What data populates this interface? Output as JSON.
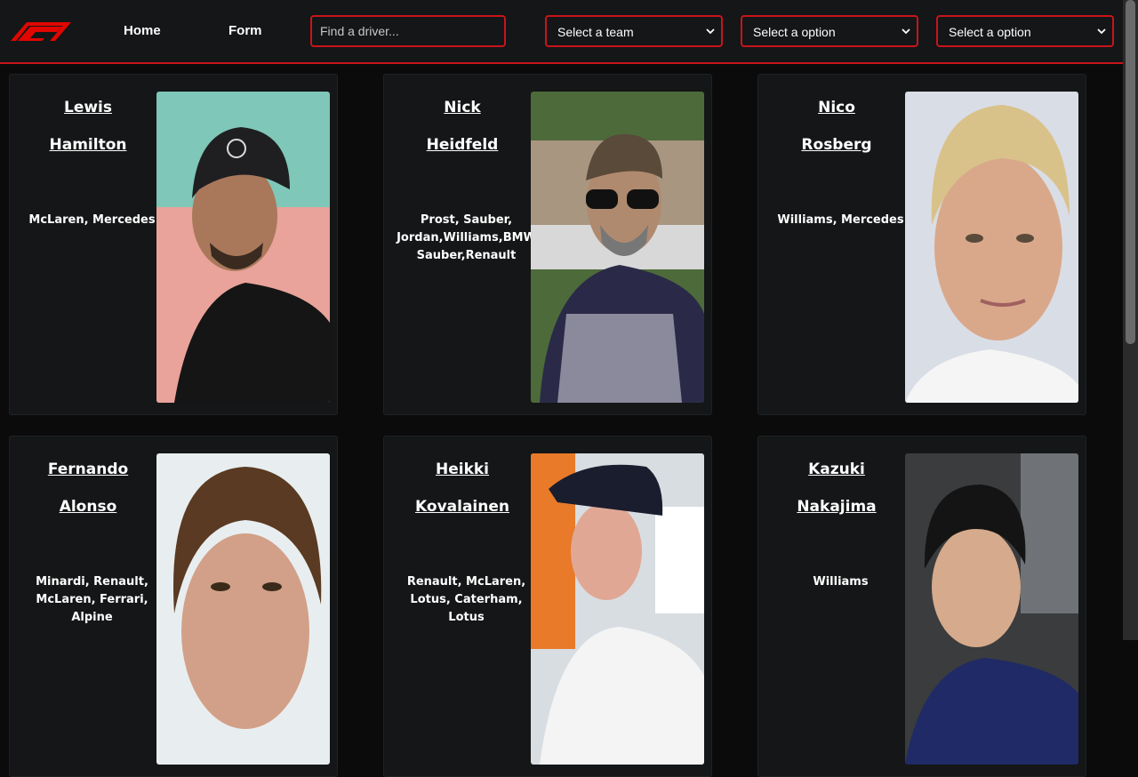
{
  "nav": {
    "logo": "F1",
    "links": [
      "Home",
      "Form"
    ],
    "search_placeholder": "Find a driver...",
    "selects": [
      "Select a team",
      "Select a option",
      "Select a option"
    ]
  },
  "drivers": [
    {
      "first": "Lewis",
      "last": "Hamilton",
      "teams": [
        "McLaren, Mercedes"
      ]
    },
    {
      "first": "Nick",
      "last": "Heidfeld",
      "teams": [
        "Prost, Sauber,",
        "Jordan,Williams,BMW",
        "Sauber,Renault"
      ]
    },
    {
      "first": "Nico",
      "last": "Rosberg",
      "teams": [
        "Williams, Mercedes"
      ]
    },
    {
      "first": "Fernando",
      "last": "Alonso",
      "teams": [
        "Minardi, Renault,",
        "McLaren, Ferrari,",
        "Alpine"
      ]
    },
    {
      "first": "Heikki",
      "last": "Kovalainen",
      "teams": [
        "Renault, McLaren,",
        "Lotus, Caterham,",
        "Lotus"
      ]
    },
    {
      "first": "Kazuki",
      "last": "Nakajima",
      "teams": [
        "Williams"
      ]
    }
  ],
  "colors": {
    "accent": "#c8151b",
    "background": "#0b0b0c",
    "panel": "#141617"
  }
}
